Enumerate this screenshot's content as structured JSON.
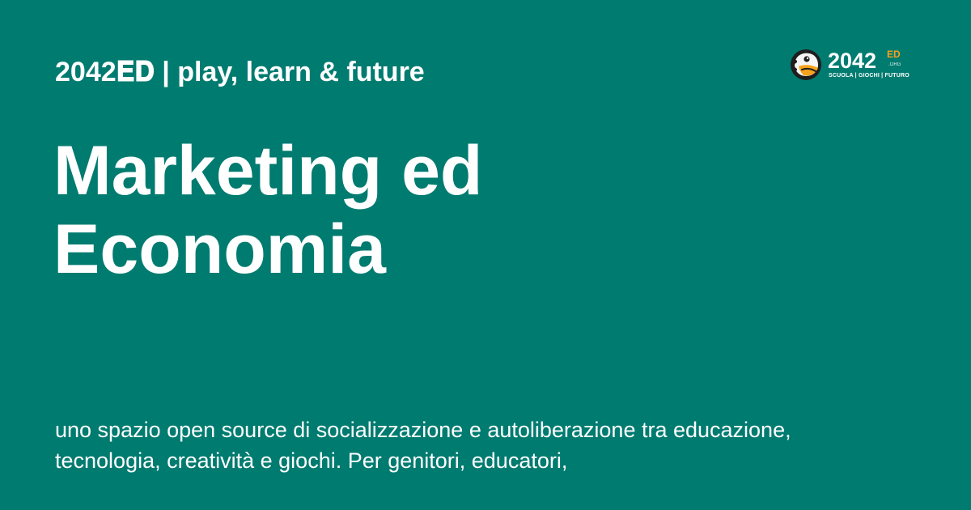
{
  "page": {
    "background_color": "#007b70",
    "text_color": "#ffffff"
  },
  "header": {
    "site_title": "2042𝐄𝐃 | play, learn & future"
  },
  "logo": {
    "number": "2042",
    "superscript": "ED",
    "domain": ".ORG",
    "tagline": "SCUOLA | GIOCHI | FUTURO",
    "accent_color": "#f6a21c",
    "icon": "mascot-logo-icon"
  },
  "content": {
    "title_lines": [
      "Marketing ed",
      "Economia"
    ],
    "description": "uno spazio open source di socializzazione e autoliberazione tra educazione, tecnologia, creatività e giochi. Per genitori, educatori,"
  }
}
